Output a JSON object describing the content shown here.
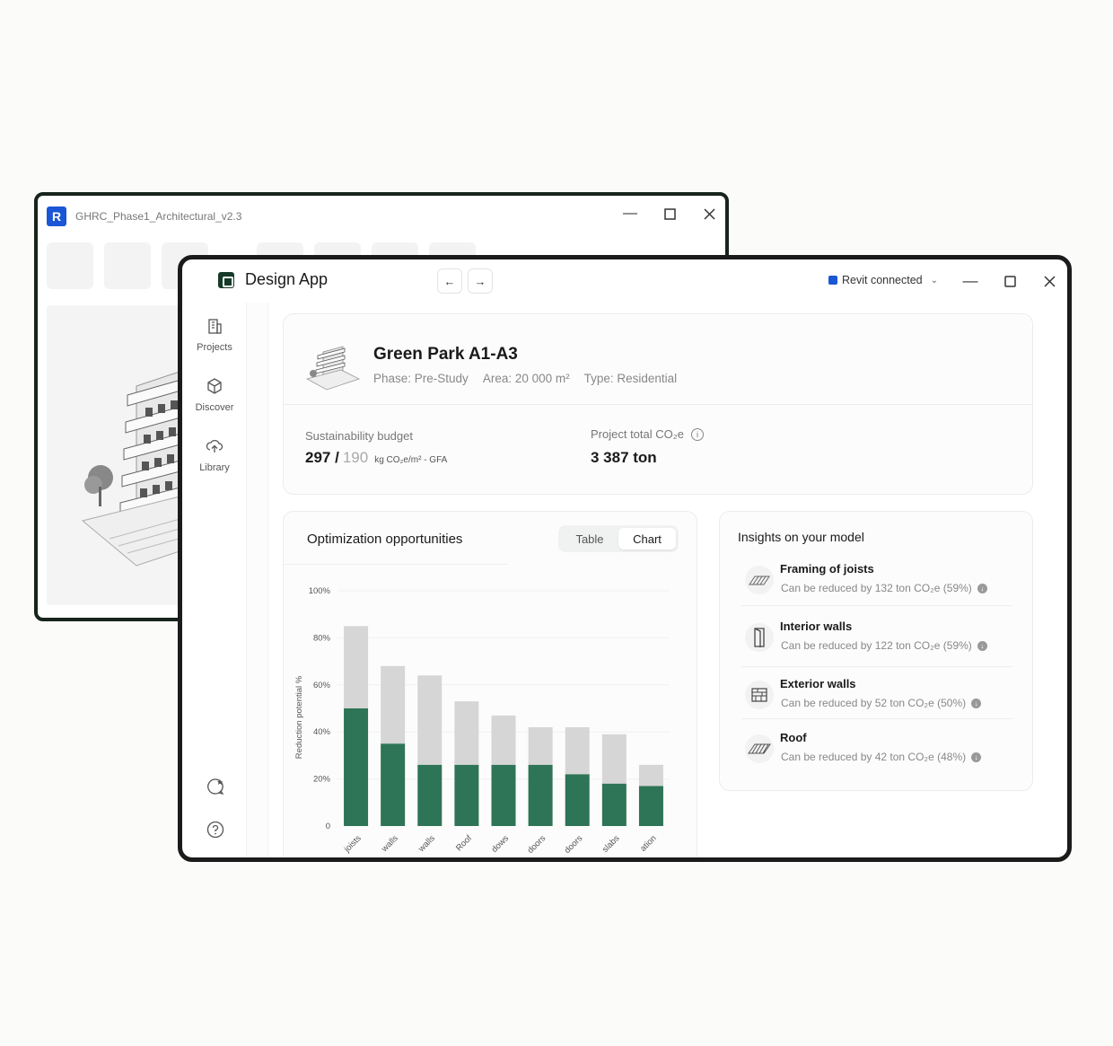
{
  "revit_window": {
    "file_name": "GHRC_Phase1_Architectural_v2.3",
    "logo_letter": "R"
  },
  "app": {
    "title": "Design App",
    "revit_status": "Revit connected",
    "nav": {
      "back": "←",
      "forward": "→"
    }
  },
  "sidebar": {
    "items": [
      {
        "label": "Projects",
        "icon": "building-icon"
      },
      {
        "label": "Discover",
        "icon": "cube-icon"
      },
      {
        "label": "Library",
        "icon": "cloud-upload-icon"
      }
    ]
  },
  "project": {
    "name": "Green Park A1-A3",
    "phase": "Phase: Pre-Study",
    "area": "Area: 20 000 m²",
    "type": "Type: Residential",
    "budget_label": "Sustainability budget",
    "budget_actual": "297 /",
    "budget_target": "190",
    "budget_unit": "kg CO₂e/m² - GFA",
    "total_label": "Project total CO₂e",
    "total_value": "3 387 ton"
  },
  "optimization": {
    "title": "Optimization opportunities",
    "toggle": {
      "table": "Table",
      "chart": "Chart",
      "active": "Chart"
    }
  },
  "chart_data": {
    "type": "bar",
    "ylabel": "Reduction potential %",
    "ylim": [
      0,
      100
    ],
    "yticks": [
      "0",
      "20%",
      "40%",
      "60%",
      "80%",
      "100%"
    ],
    "categories": [
      "joists",
      "walls",
      "walls",
      "Roof",
      "dows",
      "doors",
      "doors",
      "slabs",
      "ation"
    ],
    "series": [
      {
        "values": [
          50,
          35,
          26,
          26,
          26,
          26,
          22,
          18,
          17
        ],
        "color": "#2e7456"
      },
      {
        "values": [
          35,
          33,
          38,
          27,
          21,
          16,
          20,
          21,
          9
        ],
        "color": "#d6d6d6"
      }
    ]
  },
  "insights": {
    "title": "Insights on your model",
    "items": [
      {
        "name": "Framing of joists",
        "desc": "Can be reduced by 132 ton CO₂e (59%)",
        "icon": "joists-icon"
      },
      {
        "name": "Interior walls",
        "desc": "Can be reduced by 122 ton CO₂e (59%)",
        "icon": "door-icon"
      },
      {
        "name": "Exterior walls",
        "desc": "Can be reduced by 52 ton CO₂e (50%)",
        "icon": "wall-icon"
      },
      {
        "name": "Roof",
        "desc": "Can be reduced by 42 ton CO₂e (48%)",
        "icon": "roof-icon"
      }
    ]
  },
  "colors": {
    "accent_green": "#2e7456",
    "bar_grey": "#d6d6d6",
    "revit_blue": "#1a56d6"
  }
}
